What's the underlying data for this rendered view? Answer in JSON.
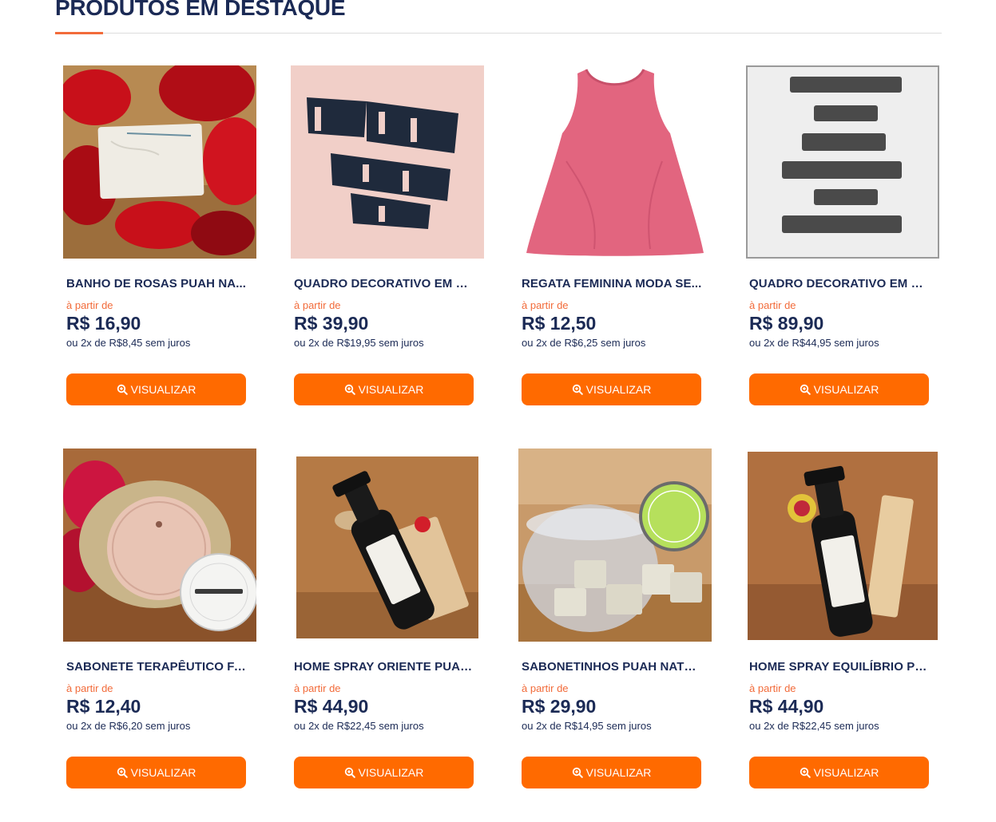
{
  "section": {
    "title": "PRODUTOS EM DESTAQUE"
  },
  "colors": {
    "accent": "#ff6a00",
    "title_underline": "#f26b3a",
    "text": "#1b2a55"
  },
  "products": [
    {
      "name": "BANHO DE ROSAS PUAH NA...",
      "price_prefix": "à partir de",
      "price": "R$ 16,90",
      "installments": "ou 2x de R$8,45 sem juros",
      "button_label": "VISUALIZAR",
      "button_icon": "zoom-icon"
    },
    {
      "name": "QUADRO DECORATIVO EM M...",
      "price_prefix": "à partir de",
      "price": "R$ 39,90",
      "installments": "ou 2x de R$19,95 sem juros",
      "button_label": "VISUALIZAR",
      "button_icon": "zoom-icon"
    },
    {
      "name": "REGATA FEMININA MODA SE...",
      "price_prefix": "à partir de",
      "price": "R$ 12,50",
      "installments": "ou 2x de R$6,25 sem juros",
      "button_label": "VISUALIZAR",
      "button_icon": "zoom-icon"
    },
    {
      "name": "QUADRO DECORATIVO EM M...",
      "price_prefix": "à partir de",
      "price": "R$ 89,90",
      "installments": "ou 2x de R$44,95 sem juros",
      "button_label": "VISUALIZAR",
      "button_icon": "zoom-icon"
    },
    {
      "name": "SABONETE TERAPÊUTICO FA...",
      "price_prefix": "à partir de",
      "price": "R$ 12,40",
      "installments": "ou 2x de R$6,20 sem juros",
      "button_label": "VISUALIZAR",
      "button_icon": "zoom-icon"
    },
    {
      "name": "HOME SPRAY ORIENTE PUAH...",
      "price_prefix": "à partir de",
      "price": "R$ 44,90",
      "installments": "ou 2x de R$22,45 sem juros",
      "button_label": "VISUALIZAR",
      "button_icon": "zoom-icon"
    },
    {
      "name": "SABONETINHOS PUAH NATU...",
      "price_prefix": "à partir de",
      "price": "R$ 29,90",
      "installments": "ou 2x de R$14,95 sem juros",
      "button_label": "VISUALIZAR",
      "button_icon": "zoom-icon"
    },
    {
      "name": "HOME SPRAY EQUILÍBRIO PU...",
      "price_prefix": "à partir de",
      "price": "R$ 44,90",
      "installments": "ou 2x de R$22,45 sem juros",
      "button_label": "VISUALIZAR",
      "button_icon": "zoom-icon"
    }
  ]
}
